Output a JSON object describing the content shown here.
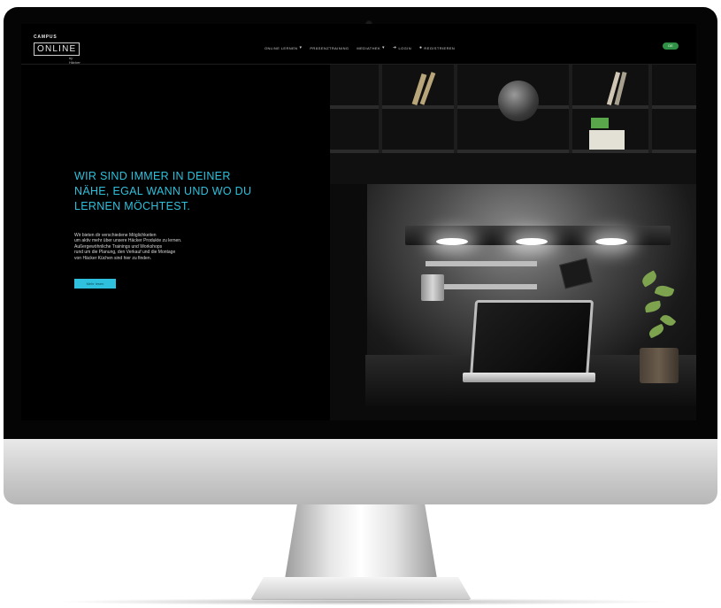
{
  "header": {
    "logo_top": "CAMPUS",
    "logo_main": "ONLINE",
    "logo_by": "by Häcker"
  },
  "nav": {
    "items": [
      {
        "label": "ONLINE LERNEN",
        "has_dropdown": true,
        "icon": ""
      },
      {
        "label": "PRÄSENZTRAINING",
        "has_dropdown": false,
        "icon": ""
      },
      {
        "label": "MEDIATHEK",
        "has_dropdown": true,
        "icon": ""
      },
      {
        "label": "LOGIN",
        "has_dropdown": false,
        "icon": "login-arrow-icon"
      },
      {
        "label": "REGISTRIEREN",
        "has_dropdown": false,
        "icon": "user-icon"
      }
    ],
    "language_toggle": "DE"
  },
  "hero": {
    "title": "WIR SIND IMMER IN DEINER NÄHE, EGAL WANN UND WO DU LERNEN MÖCHTEST.",
    "body_lines": [
      "Wir bieten dir verschiedene Möglichkeiten",
      "um aktiv mehr über unsere Häcker Produkte zu lernen.",
      "Außergewöhnliche Trainings und Workshops",
      "rund um die Planung, den Verkauf und die Montage",
      "von Häcker Küchen sind hier zu finden."
    ],
    "cta_label": "Mehr lesen"
  },
  "colors": {
    "accent": "#2ec0dc",
    "background": "#000000",
    "toggle": "#2f8f45"
  }
}
